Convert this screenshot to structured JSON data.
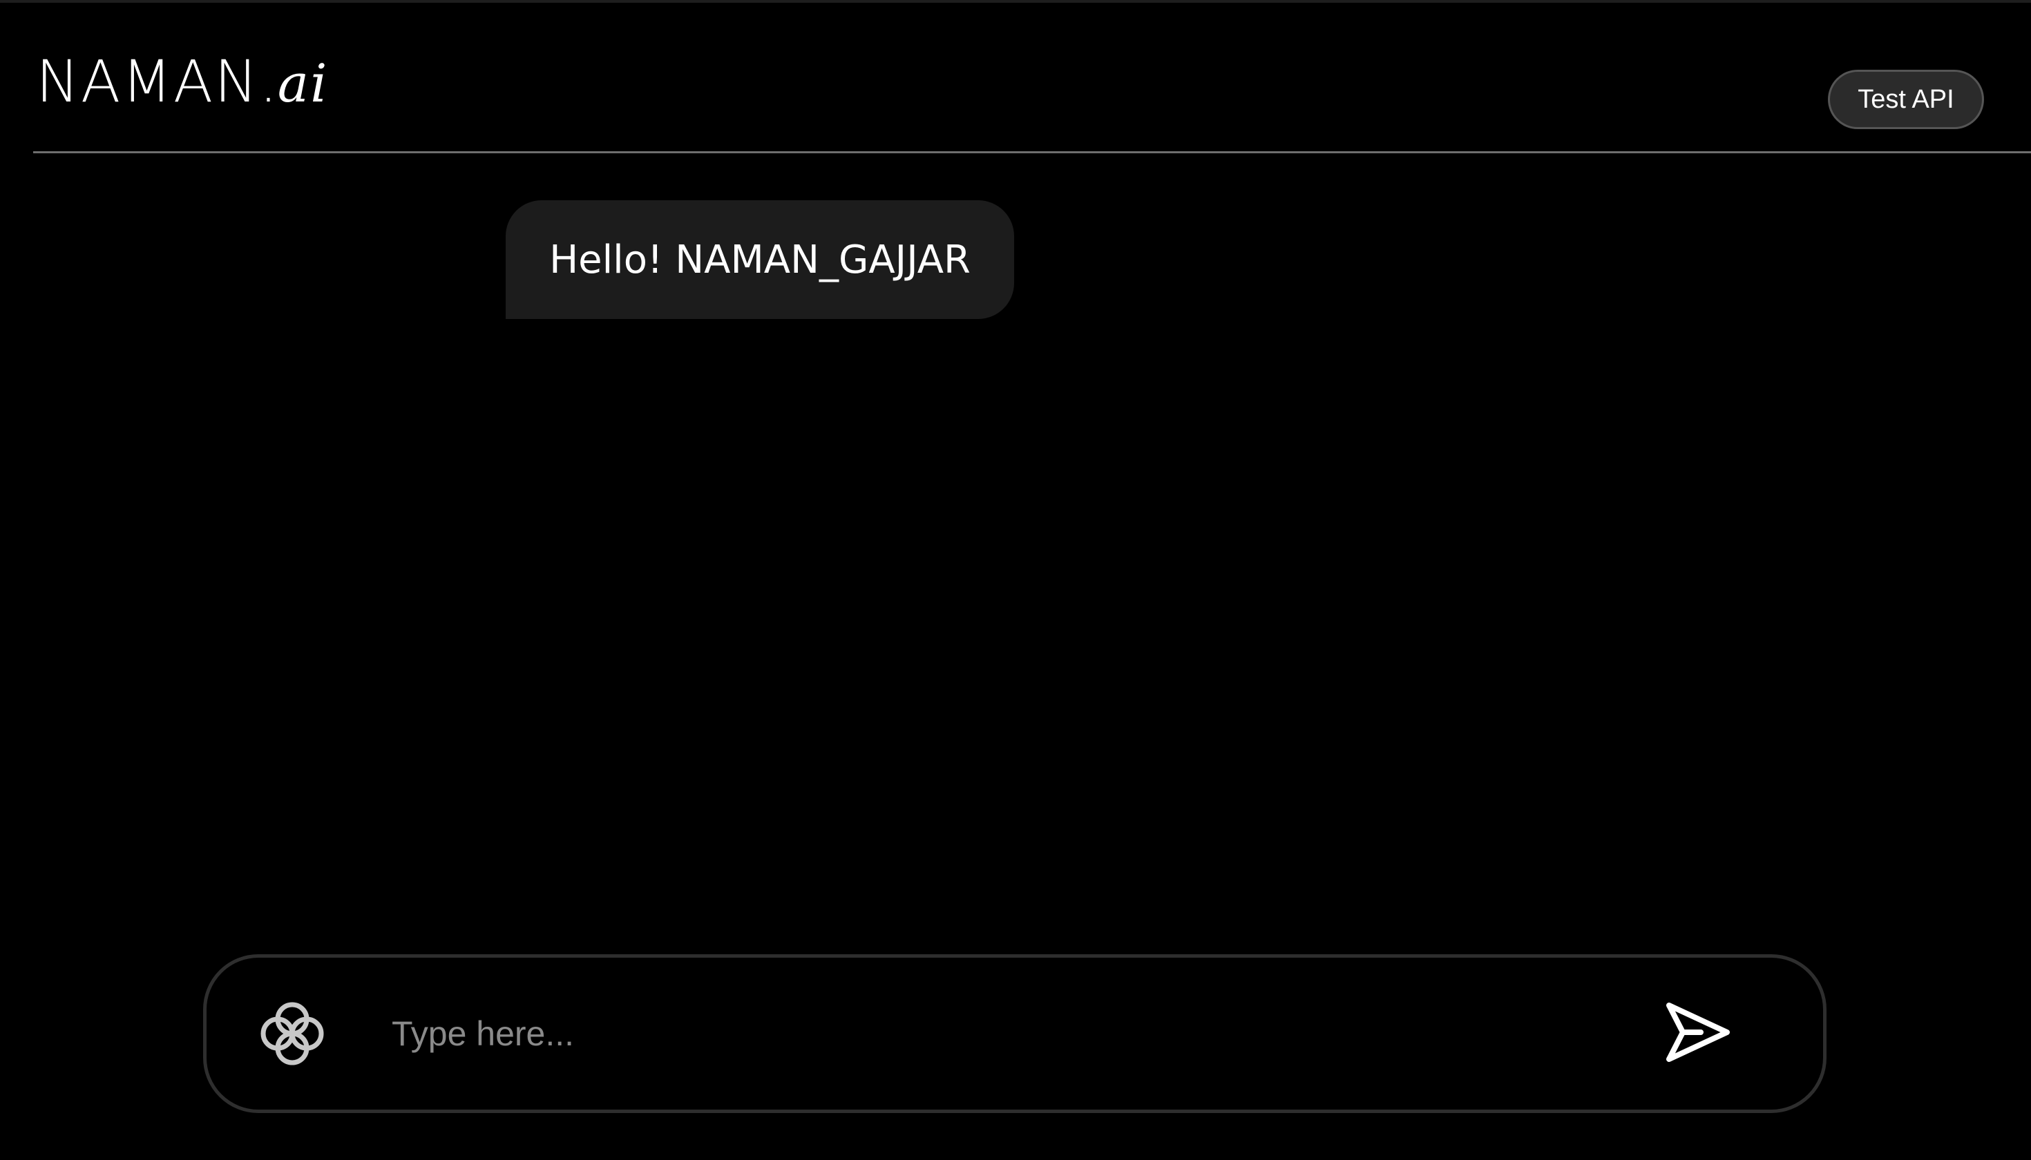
{
  "header": {
    "logo_main": "NAMAN",
    "logo_dot": ".",
    "logo_suffix": "ai",
    "test_api_label": "Test API"
  },
  "chat": {
    "messages": [
      {
        "text": "Hello! NAMAN_GAJJAR"
      }
    ]
  },
  "composer": {
    "value": "",
    "placeholder": "Type here...",
    "left_icon": "flower-icon",
    "send_icon": "send-icon"
  },
  "colors": {
    "background": "#000000",
    "bubble": "#1c1c1c",
    "button_bg": "#2b2b2b",
    "divider": "#6e6e6e",
    "placeholder": "#8a8a8a",
    "text": "#ffffff"
  }
}
